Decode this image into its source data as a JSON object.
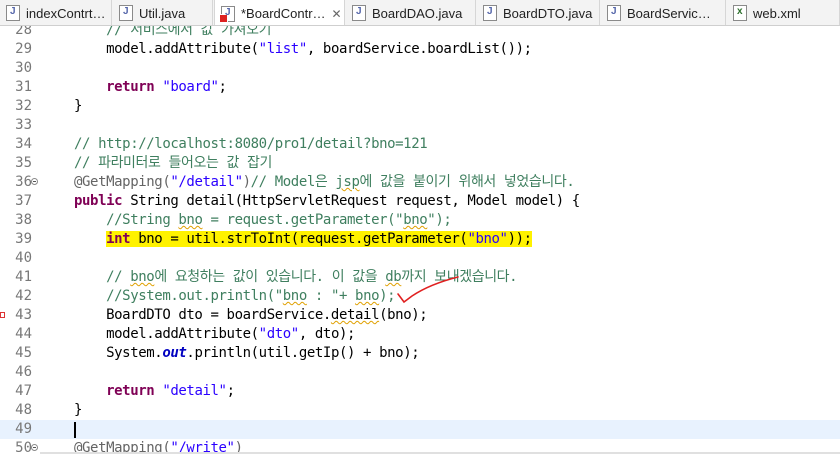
{
  "tabs": [
    {
      "label": "indexContrt…",
      "icon": "java-file-icon",
      "active": false
    },
    {
      "label": "Util.java",
      "icon": "java-file-icon",
      "active": false
    },
    {
      "label": "*BoardContr…",
      "icon": "java-file-error-icon",
      "active": true,
      "close": "✕"
    },
    {
      "label": "BoardDAO.java",
      "icon": "java-file-icon",
      "active": false
    },
    {
      "label": "BoardDTO.java",
      "icon": "java-file-icon",
      "active": false
    },
    {
      "label": "BoardServic…",
      "icon": "java-file-icon",
      "active": false
    },
    {
      "label": "web.xml",
      "icon": "xml-file-icon",
      "active": false
    }
  ],
  "editor": {
    "lines": [
      {
        "n": "28",
        "tokens": [
          {
            "t": "    ",
            "c": ""
          },
          {
            "t": "// 서비스에서 값 가져오기",
            "c": "cm"
          }
        ]
      },
      {
        "n": "29",
        "tokens": [
          {
            "t": "    model.addAttribute(",
            "c": ""
          },
          {
            "t": "\"list\"",
            "c": "str"
          },
          {
            "t": ", boardService.boardList());",
            "c": ""
          }
        ]
      },
      {
        "n": "30",
        "tokens": []
      },
      {
        "n": "31",
        "tokens": [
          {
            "t": "    ",
            "c": ""
          },
          {
            "t": "return",
            "c": "kw"
          },
          {
            "t": " ",
            "c": ""
          },
          {
            "t": "\"board\"",
            "c": "str"
          },
          {
            "t": ";",
            "c": ""
          }
        ]
      },
      {
        "n": "32",
        "tokens": [
          {
            "t": "}",
            "c": ""
          }
        ]
      },
      {
        "n": "33",
        "tokens": []
      },
      {
        "n": "34",
        "tokens": [
          {
            "t": "// http://localhost:8080/pro1/detail?bno=121",
            "c": "cm"
          }
        ]
      },
      {
        "n": "35",
        "tokens": [
          {
            "t": "// 파라미터로 들어오는 값 잡기",
            "c": "cm"
          }
        ]
      },
      {
        "n": "36",
        "fold": true,
        "tokens": [
          {
            "t": "@GetMapping(",
            "c": "ann"
          },
          {
            "t": "\"/detail\"",
            "c": "str"
          },
          {
            "t": ")",
            "c": "ann"
          },
          {
            "t": "// Model은 ",
            "c": "cm"
          },
          {
            "t": "jsp",
            "c": "cm squig"
          },
          {
            "t": "에 값을 붙이기 위해서 넣었습니다.",
            "c": "cm"
          }
        ]
      },
      {
        "n": "37",
        "tokens": [
          {
            "t": "public",
            "c": "kw"
          },
          {
            "t": " String detail(HttpServletRequest ",
            "c": ""
          },
          {
            "t": "request",
            "c": ""
          },
          {
            "t": ", Model model) {",
            "c": ""
          }
        ]
      },
      {
        "n": "38",
        "tokens": [
          {
            "t": "    ",
            "c": ""
          },
          {
            "t": "//String ",
            "c": "cm"
          },
          {
            "t": "bno",
            "c": "cm squig"
          },
          {
            "t": " = request.getParameter(\"",
            "c": "cm"
          },
          {
            "t": "bno",
            "c": "cm squig"
          },
          {
            "t": "\");",
            "c": "cm"
          }
        ]
      },
      {
        "n": "39",
        "highlight": true,
        "tokens": [
          {
            "t": "    ",
            "c": ""
          },
          {
            "t": "int",
            "c": "kw hl"
          },
          {
            "t": " bno = util.strToInt(request.getParameter(",
            "c": "hl"
          },
          {
            "t": "\"bno\"",
            "c": "str hl"
          },
          {
            "t": "));",
            "c": "hl"
          }
        ]
      },
      {
        "n": "40",
        "tokens": []
      },
      {
        "n": "41",
        "tokens": [
          {
            "t": "    ",
            "c": ""
          },
          {
            "t": "// ",
            "c": "cm"
          },
          {
            "t": "bno",
            "c": "cm squig"
          },
          {
            "t": "에 요청하는 값이 있습니다. 이 값을 ",
            "c": "cm"
          },
          {
            "t": "db",
            "c": "cm squig"
          },
          {
            "t": "까지 보내겠습니다.",
            "c": "cm"
          }
        ]
      },
      {
        "n": "42",
        "tokens": [
          {
            "t": "    ",
            "c": ""
          },
          {
            "t": "//System.out.println(\"",
            "c": "cm"
          },
          {
            "t": "bno",
            "c": "cm squig"
          },
          {
            "t": " : \"+ ",
            "c": "cm"
          },
          {
            "t": "bno",
            "c": "cm squig"
          },
          {
            "t": ");",
            "c": "cm"
          }
        ]
      },
      {
        "n": "43",
        "error": true,
        "tokens": [
          {
            "t": "    BoardDTO dto = boardService.",
            "c": ""
          },
          {
            "t": "detail",
            "c": "squig"
          },
          {
            "t": "(bno);",
            "c": ""
          }
        ]
      },
      {
        "n": "44",
        "tokens": [
          {
            "t": "    model.addAttribute(",
            "c": ""
          },
          {
            "t": "\"dto\"",
            "c": "str"
          },
          {
            "t": ", dto);",
            "c": ""
          }
        ]
      },
      {
        "n": "45",
        "tokens": [
          {
            "t": "    System.",
            "c": ""
          },
          {
            "t": "out",
            "c": "it"
          },
          {
            "t": ".println(util.getIp() + bno);",
            "c": ""
          }
        ]
      },
      {
        "n": "46",
        "tokens": []
      },
      {
        "n": "47",
        "tokens": [
          {
            "t": "    ",
            "c": ""
          },
          {
            "t": "return",
            "c": "kw"
          },
          {
            "t": " ",
            "c": ""
          },
          {
            "t": "\"detail\"",
            "c": "str"
          },
          {
            "t": ";",
            "c": ""
          }
        ]
      },
      {
        "n": "48",
        "tokens": [
          {
            "t": "}",
            "c": ""
          }
        ]
      },
      {
        "n": "49",
        "current": true,
        "tokens": []
      },
      {
        "n": "50",
        "fold": true,
        "tokens": [
          {
            "t": "@GetMapping(",
            "c": "ann"
          },
          {
            "t": "\"/write\"",
            "c": "str"
          },
          {
            "t": ")",
            "c": "ann"
          }
        ]
      }
    ]
  },
  "colors": {
    "keyword": "#7f0055",
    "string": "#2a00ff",
    "comment": "#3f7f5f",
    "highlight": "#fff200",
    "annotation_pen": "#e02020"
  }
}
